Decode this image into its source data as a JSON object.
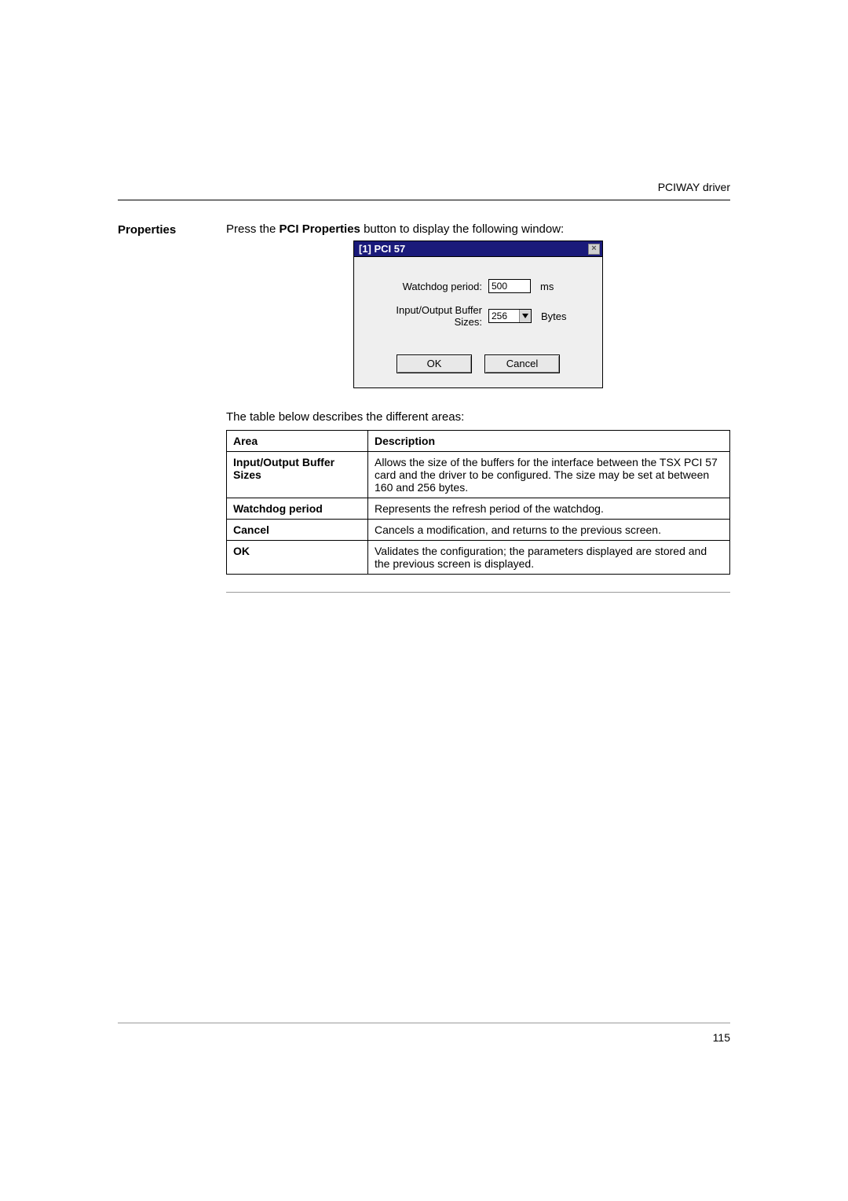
{
  "header": {
    "doc_title": "PCIWAY driver"
  },
  "section": {
    "side_label": "Properties",
    "intro_prefix": "Press the ",
    "intro_bold": "PCI Properties",
    "intro_suffix": " button to display the following window:"
  },
  "dialog": {
    "title": "[1] PCI 57",
    "close_glyph": "×",
    "watchdog_label": "Watchdog period:",
    "watchdog_value": "500",
    "watchdog_unit": "ms",
    "buffer_label": "Input/Output Buffer Sizes:",
    "buffer_value": "256",
    "buffer_unit": "Bytes",
    "ok_label": "OK",
    "cancel_label": "Cancel"
  },
  "table": {
    "intro": "The table below describes the different areas:",
    "head_area": "Area",
    "head_desc": "Description",
    "rows": [
      {
        "area": "Input/Output Buffer Sizes",
        "desc": "Allows the size of the buffers for the interface between the TSX PCI 57 card and the driver to be configured. The size may be set at between 160 and 256 bytes."
      },
      {
        "area": "Watchdog period",
        "desc": "Represents the refresh period of the watchdog."
      },
      {
        "area": "Cancel",
        "desc": "Cancels a modification, and returns to the previous screen."
      },
      {
        "area": " OK",
        "desc": "Validates the configuration; the parameters displayed are stored and the previous screen is displayed."
      }
    ]
  },
  "footer": {
    "page_number": "115"
  }
}
